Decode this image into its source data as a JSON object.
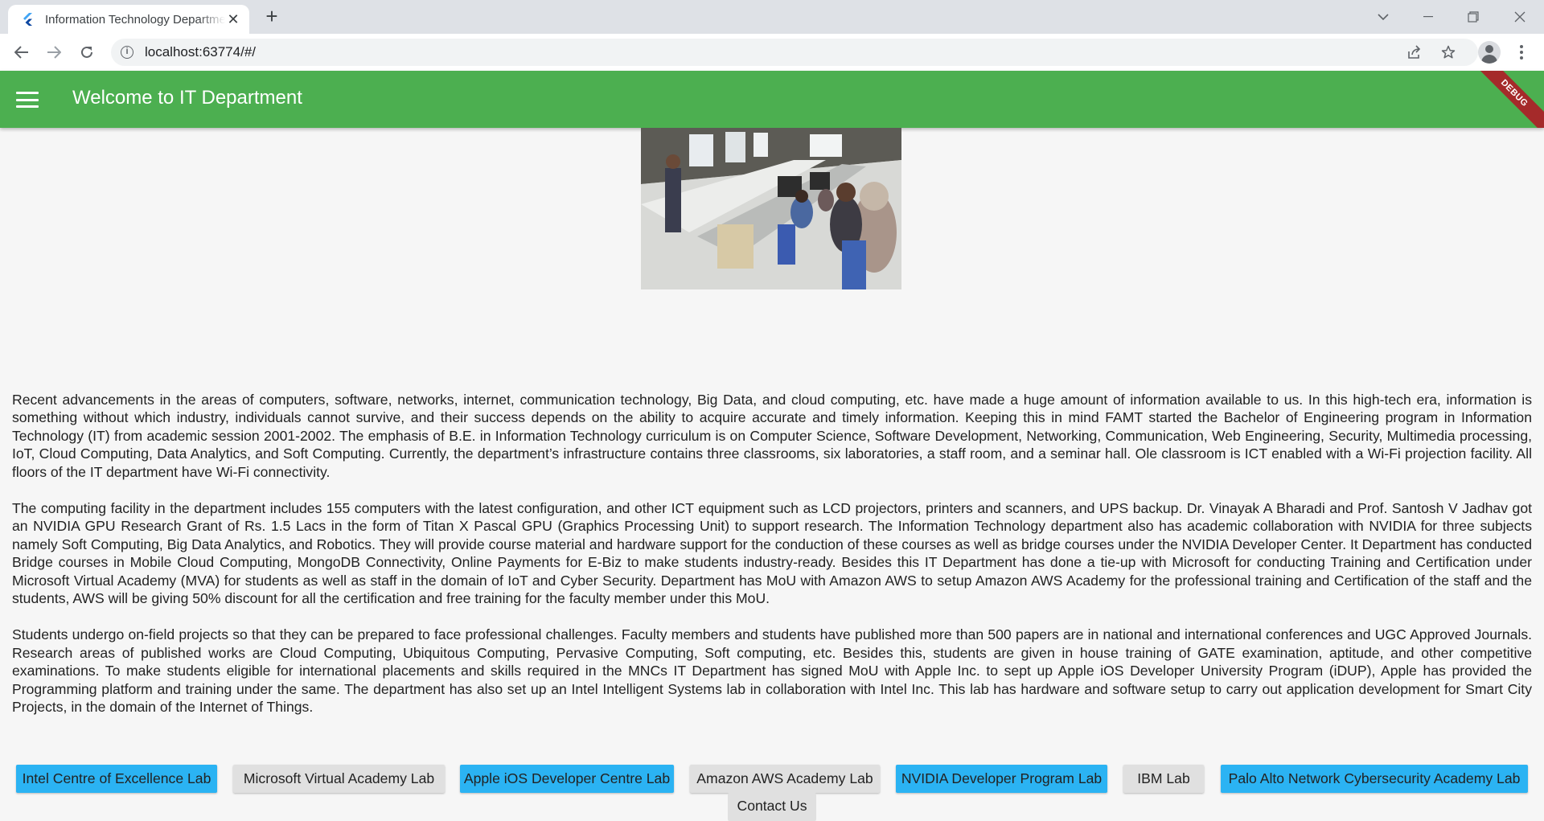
{
  "browser": {
    "tab_title": "Information Technology Department",
    "new_tab_symbol": "+",
    "url": "localhost:63774/#/"
  },
  "app": {
    "title": "Welcome to IT Department",
    "debug_label": "DEBUG",
    "bar_color": "#4caf50"
  },
  "content": {
    "paragraphs": [
      "Recent advancements in the areas of computers, software, networks, internet, communication technology, Big Data, and cloud computing, etc. have made a huge amount of information available to us. In this high-tech era, information is something without which industry, individuals cannot survive, and their success depends on the ability to acquire accurate and timely information. Keeping this in mind FAMT started the Bachelor of Engineering program in Information Technology (IT) from academic session 2001-2002. The emphasis of B.E. in Information Technology curriculum is on Computer Science, Software Development, Networking, Communication, Web Engineering, Security, Multimedia processing, IoT, Cloud Computing, Data Analytics, and Soft Computing. Currently, the department’s infrastructure contains three classrooms, six laboratories, a staff room, and a seminar hall. Ole classroom is ICT enabled with a Wi-Fi projection facility. All floors of the IT department have Wi-Fi connectivity.",
      "The computing facility in the department includes 155 computers with the latest configuration, and other ICT equipment such as LCD projectors, printers and scanners, and UPS backup. Dr. Vinayak A Bharadi and Prof. Santosh V Jadhav got an NVIDIA GPU Research Grant of Rs. 1.5 Lacs in the form of Titan X Pascal GPU (Graphics Processing Unit) to support research. The Information Technology department also has academic collaboration with NVIDIA for three subjects namely Soft Computing, Big Data Analytics, and Robotics. They will provide course material and hardware support for the conduction of these courses as well as bridge courses under the NVIDIA Developer Center. It Department has conducted Bridge courses in Mobile Cloud Computing, MongoDB Connectivity, Online Payments for E-Biz to make students industry-ready. Besides this IT Department has done a tie-up with Microsoft for conducting Training and Certification under Microsoft Virtual Academy (MVA) for students as well as staff in the domain of IoT and Cyber Security. Department has MoU with Amazon AWS to setup Amazon AWS Academy for the professional training and Certification of the staff and the students, AWS will be giving 50% discount for all the certification and free training for the faculty member under this MoU.",
      "Students undergo on-field projects so that they can be prepared to face professional challenges. Faculty members and students have published more than 500 papers are in national and international conferences and UGC Approved Journals. Research areas of published works are Cloud Computing, Ubiquitous Computing, Pervasive Computing, Soft computing, etc. Besides this, students are given in house training of GATE examination, aptitude, and other competitive examinations. To make students eligible for international placements and skills required in the MNCs IT Department has signed MoU with Apple Inc. to sept up Apple iOS Developer University Program (iDUP), Apple has provided the Programming platform and training under the same. The department has also set up an Intel Intelligent Systems lab in collaboration with Intel Inc. This lab has hardware and software setup to carry out application development for Smart City Projects, in the domain of the Internet of Things."
    ]
  },
  "lab_buttons": [
    {
      "label": "Intel Centre of Excellence Lab",
      "color": "#2bb3f3"
    },
    {
      "label": "Microsoft Virtual Academy Lab",
      "color": "#e0e0e0"
    },
    {
      "label": "Apple iOS Developer Centre Lab",
      "color": "#2bb3f3"
    },
    {
      "label": "Amazon AWS Academy Lab",
      "color": "#e0e0e0"
    },
    {
      "label": "NVIDIA Developer Program Lab",
      "color": "#2bb3f3"
    },
    {
      "label": "IBM Lab",
      "color": "#e0e0e0"
    },
    {
      "label": "Palo Alto Network Cybersecurity Academy Lab",
      "color": "#2bb3f3"
    }
  ],
  "contact_button": {
    "label": "Contact Us"
  }
}
